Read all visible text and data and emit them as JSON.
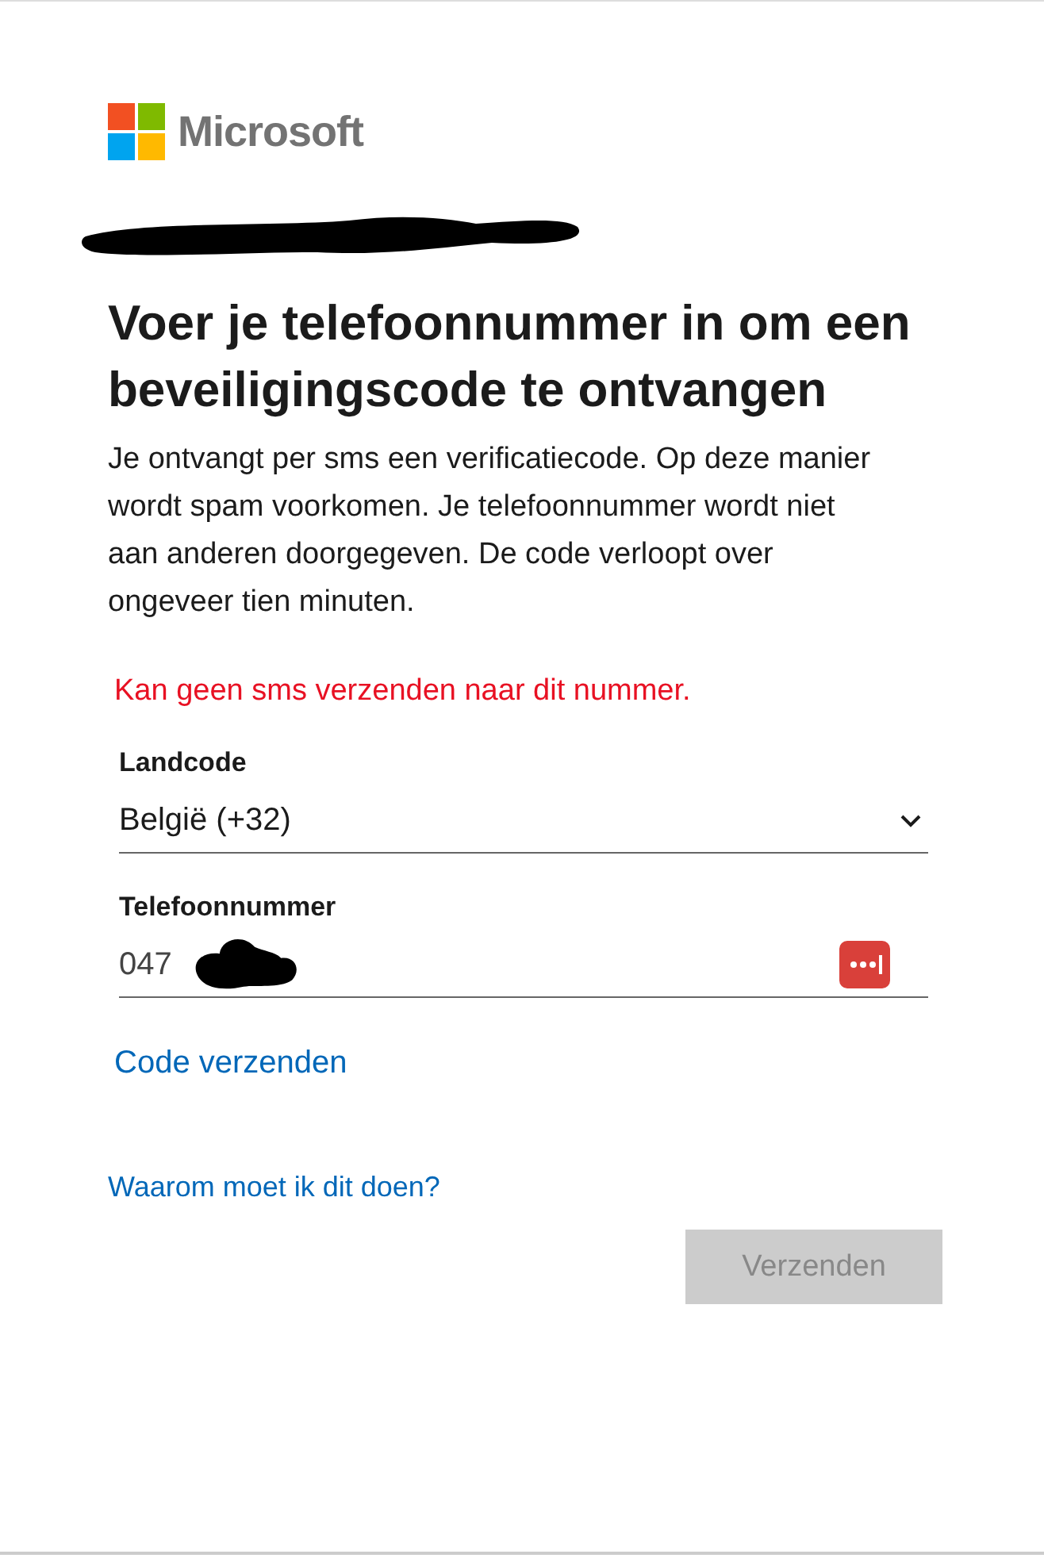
{
  "logo": {
    "text": "Microsoft"
  },
  "title": "Voer je telefoonnummer in om een beveiligingscode te ontvangen",
  "description": "Je ontvangt per sms een verificatiecode. Op deze manier wordt spam voorkomen. Je telefoonnummer wordt niet aan anderen doorgegeven. De code verloopt over ongeveer tien minuten.",
  "error": "Kan geen sms verzenden naar dit nummer.",
  "country_field": {
    "label": "Landcode",
    "value": "België (+32)"
  },
  "phone_field": {
    "label": "Telefoonnummer",
    "value": "047"
  },
  "send_code_link": "Code verzenden",
  "why_link": "Waarom moet ik dit doen?",
  "submit_button": {
    "label": "Verzenden",
    "disabled": true
  }
}
